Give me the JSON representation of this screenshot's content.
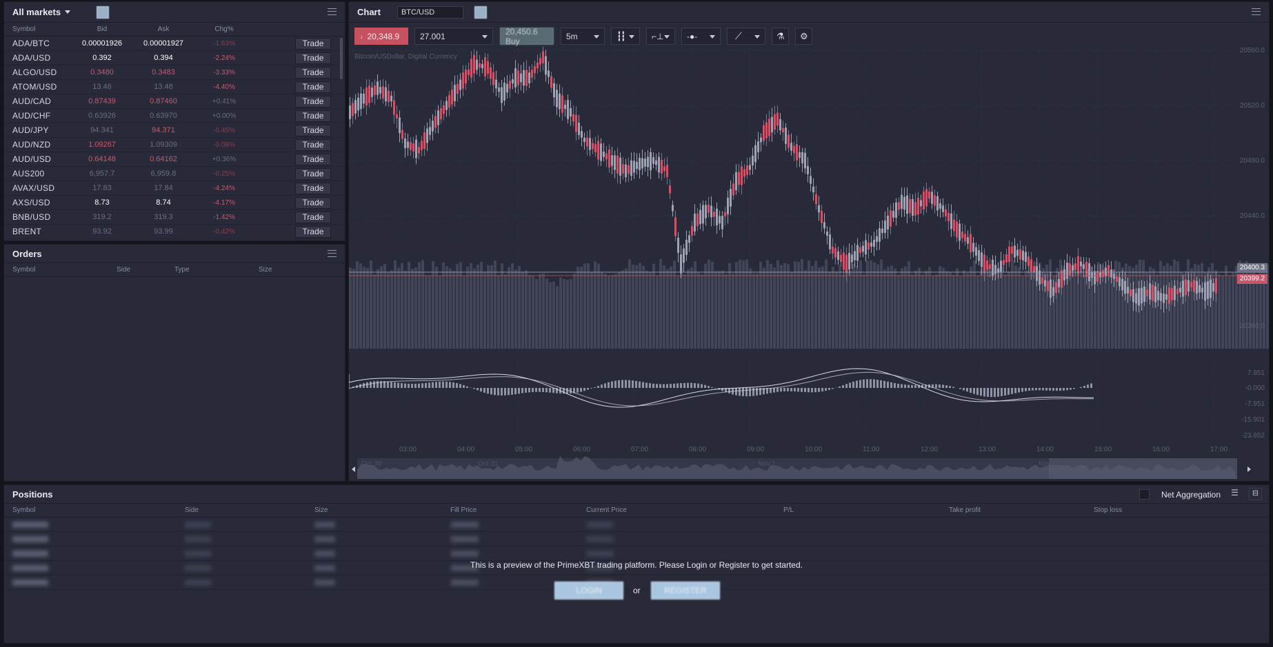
{
  "markets": {
    "title": "All markets",
    "columns": [
      "Symbol",
      "Bid",
      "Ask",
      "Chg%"
    ],
    "trade_label": "Trade",
    "rows": [
      {
        "symbol": "ADA/BTC",
        "bid": "0.00001926",
        "ask": "0.00001927",
        "chg": "-1.63%",
        "bc": "#ffffff",
        "ac": "#ffffff",
        "cc": "#8e3c4b"
      },
      {
        "symbol": "ADA/USD",
        "bid": "0.392",
        "ask": "0.394",
        "chg": "-2.24%",
        "bc": "#ffffff",
        "ac": "#ffffff",
        "cc": "#c8596b"
      },
      {
        "symbol": "ALGO/USD",
        "bid": "0.3480",
        "ask": "0.3483",
        "chg": "-3.33%",
        "bc": "#c8596b",
        "ac": "#c8596b",
        "cc": "#c8596b"
      },
      {
        "symbol": "ATOM/USD",
        "bid": "13.46",
        "ask": "13.48",
        "chg": "-4.40%",
        "bc": "#6b6d80",
        "ac": "#6b6d80",
        "cc": "#c8596b"
      },
      {
        "symbol": "AUD/CAD",
        "bid": "0.87439",
        "ask": "0.87460",
        "chg": "+0.41%",
        "bc": "#c8596b",
        "ac": "#c8596b",
        "cc": "#6b6d80"
      },
      {
        "symbol": "AUD/CHF",
        "bid": "0.63926",
        "ask": "0.63970",
        "chg": "+0.00%",
        "bc": "#6b6d80",
        "ac": "#6b6d80",
        "cc": "#6b6d80"
      },
      {
        "symbol": "AUD/JPY",
        "bid": "94.341",
        "ask": "94.371",
        "chg": "-0.45%",
        "bc": "#6b6d80",
        "ac": "#c8596b",
        "cc": "#8e3c4b"
      },
      {
        "symbol": "AUD/NZD",
        "bid": "1.09267",
        "ask": "1.09309",
        "chg": "-0.08%",
        "bc": "#c8596b",
        "ac": "#6b6d80",
        "cc": "#8e3c4b"
      },
      {
        "symbol": "AUD/USD",
        "bid": "0.64148",
        "ask": "0.64162",
        "chg": "+0.36%",
        "bc": "#c8596b",
        "ac": "#c8596b",
        "cc": "#6b6d80"
      },
      {
        "symbol": "AUS200",
        "bid": "6,957.7",
        "ask": "6,959.8",
        "chg": "-0.25%",
        "bc": "#6b6d80",
        "ac": "#6b6d80",
        "cc": "#8e3c4b"
      },
      {
        "symbol": "AVAX/USD",
        "bid": "17.83",
        "ask": "17.84",
        "chg": "-4.24%",
        "bc": "#6b6d80",
        "ac": "#6b6d80",
        "cc": "#c8596b"
      },
      {
        "symbol": "AXS/USD",
        "bid": "8.73",
        "ask": "8.74",
        "chg": "-4.17%",
        "bc": "#ffffff",
        "ac": "#ffffff",
        "cc": "#c8596b"
      },
      {
        "symbol": "BNB/USD",
        "bid": "319.2",
        "ask": "319.3",
        "chg": "-1.42%",
        "bc": "#6b6d80",
        "ac": "#6b6d80",
        "cc": "#c8596b"
      },
      {
        "symbol": "BRENT",
        "bid": "93.92",
        "ask": "93.99",
        "chg": "-0.42%",
        "bc": "#6b6d80",
        "ac": "#6b6d80",
        "cc": "#8e3c4b"
      }
    ]
  },
  "orders": {
    "title": "Orders",
    "columns": [
      "Symbol",
      "Side",
      "Type",
      "Size"
    ]
  },
  "chart": {
    "title": "Chart",
    "symbol": "BTC/USD",
    "sell_price": "20,348.9",
    "quantity": "27.001",
    "buy_price": "20,450.6 Buy",
    "interval": "5m",
    "description": "Bitcoin/USDollar, Digital Currency",
    "price_levels": [
      "20560.0",
      "20520.0",
      "20480.0",
      "20440.0",
      "20400.0",
      "20360.0"
    ],
    "badge_last": "20400.3",
    "badge_bid": "20399.2",
    "macd_levels": [
      "7.951",
      "-0.000",
      "-7.951",
      "-15.901",
      "-23.852"
    ],
    "time_labels": [
      "03:00",
      "04:00",
      "05:00",
      "06:00",
      "07:00",
      "08:00",
      "09:00",
      "10:00",
      "11:00",
      "12:00",
      "13:00",
      "14:00",
      "15:00",
      "16:00",
      "17:00"
    ],
    "nav_labels": [
      "Oct 30",
      "Oct 31",
      "Nov 1",
      "Nov 2"
    ],
    "colors": {
      "down": "#c9566a",
      "up": "#9fa3b4",
      "volume": "#4b4e62"
    }
  },
  "positions": {
    "title": "Positions",
    "net_aggregation": "Net Aggregation",
    "columns": [
      "Symbol",
      "Side",
      "Size",
      "Fill Price",
      "Current Price",
      "P/L",
      "Take profit",
      "Stop loss"
    ],
    "preview_message": "This is a preview of the PrimeXBT trading platform. Please Login or Register to get started.",
    "login_label": "LOGIN",
    "or_label": "or",
    "register_label": "REGISTER"
  }
}
